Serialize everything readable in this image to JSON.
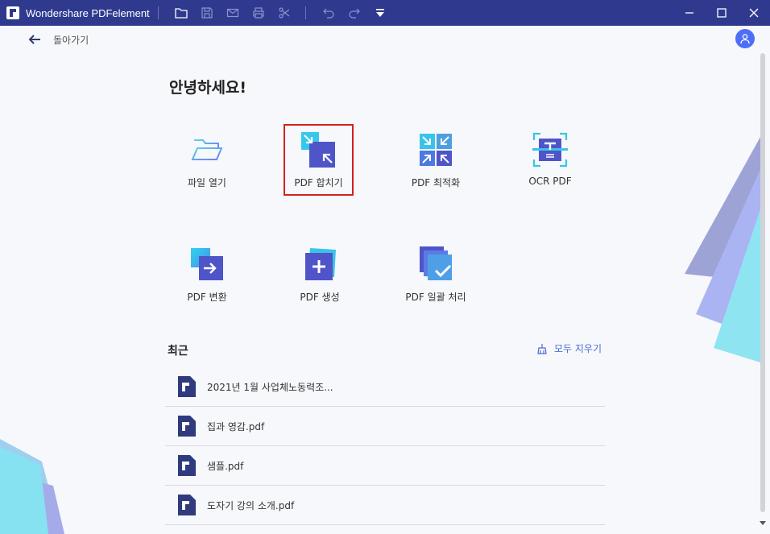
{
  "window": {
    "title": "Wondershare PDFelement"
  },
  "nav": {
    "back_label": "돌아가기"
  },
  "home": {
    "greeting": "안녕하세요!",
    "tiles": [
      {
        "label": "파일 열기",
        "icon": "folder-open-icon"
      },
      {
        "label": "PDF 합치기",
        "icon": "combine-pdf-icon"
      },
      {
        "label": "PDF 최적화",
        "icon": "optimize-pdf-icon"
      },
      {
        "label": "OCR PDF",
        "icon": "ocr-icon"
      },
      {
        "label": "PDF 변환",
        "icon": "convert-pdf-icon"
      },
      {
        "label": "PDF 생성",
        "icon": "create-pdf-icon"
      },
      {
        "label": "PDF 일괄 처리",
        "icon": "batch-process-icon"
      }
    ]
  },
  "recent": {
    "title": "최근",
    "clear_label": "모두 지우기",
    "files": [
      {
        "name": "2021년 1월 사업체노동력조..."
      },
      {
        "name": "집과 영감.pdf"
      },
      {
        "name": "샘플.pdf"
      },
      {
        "name": "도자기 강의 소개.pdf"
      }
    ]
  },
  "colors": {
    "titlebar": "#2f3a8f",
    "accent": "#4c6cd6",
    "highlight": "#d42020"
  }
}
